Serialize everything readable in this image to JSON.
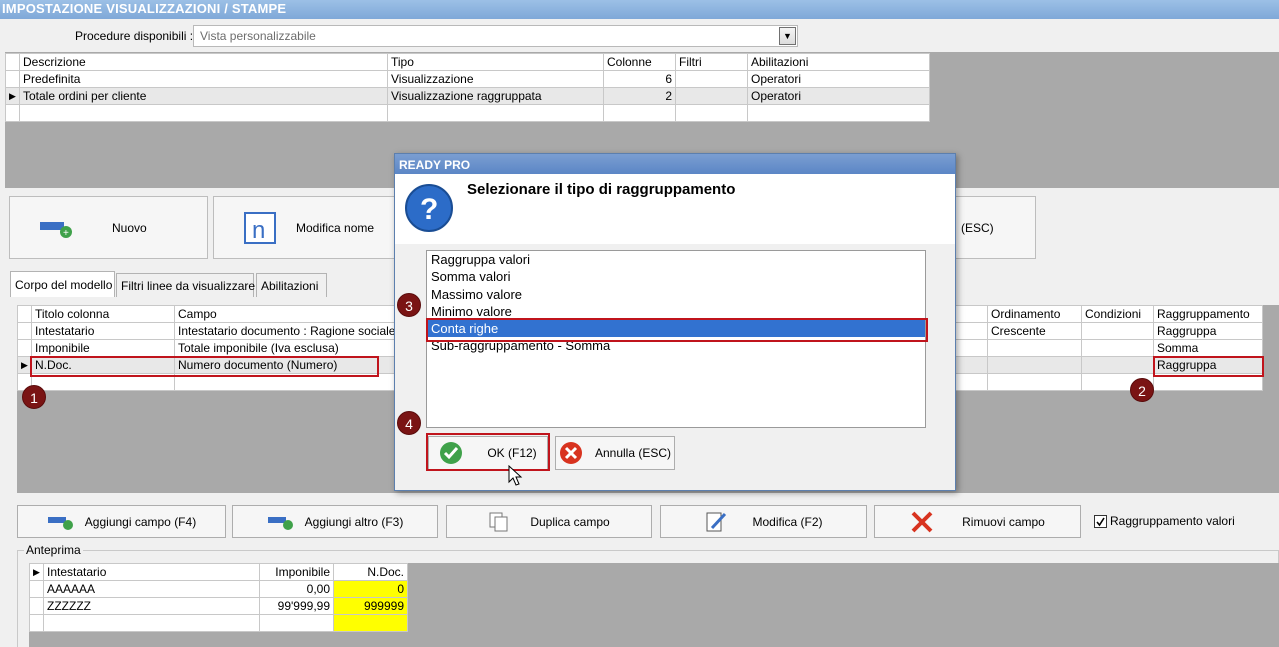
{
  "window": {
    "title": "IMPOSTAZIONE VISUALIZZAZIONI / STAMPE"
  },
  "procedure": {
    "label": "Procedure disponibili :",
    "value": "Vista personalizzabile"
  },
  "views_table": {
    "headers": [
      "Descrizione",
      "Tipo",
      "Colonne",
      "Filtri",
      "Abilitazioni"
    ],
    "rows": [
      {
        "descrizione": "Predefinita",
        "tipo": "Visualizzazione",
        "colonne": "6",
        "filtri": "",
        "abilitazioni": "Operatori"
      },
      {
        "descrizione": "Totale ordini per cliente",
        "tipo": "Visualizzazione raggruppata",
        "colonne": "2",
        "filtri": "",
        "abilitazioni": "Operatori"
      }
    ]
  },
  "toolbar": {
    "nuovo": "Nuovo",
    "modifica_nome": "Modifica nome",
    "esc_partial": "(ESC)"
  },
  "tabs": [
    "Corpo del modello",
    "Filtri linee da visualizzare",
    "Abilitazioni"
  ],
  "fields_table": {
    "headers": [
      "Titolo colonna",
      "Campo",
      "Ordinamento",
      "Condizioni",
      "Raggruppamento"
    ],
    "rows": [
      {
        "titolo": "Intestatario",
        "campo": "Intestatario documento : Ragione sociale",
        "ordinamento": "Crescente",
        "condizioni": "",
        "raggruppamento": "Raggruppa"
      },
      {
        "titolo": "Imponibile",
        "campo": "Totale imponibile (Iva esclusa)",
        "ordinamento": "",
        "condizioni": "",
        "raggruppamento": "Somma"
      },
      {
        "titolo": "N.Doc.",
        "campo": "Numero documento (Numero)",
        "ordinamento": "",
        "condizioni": "",
        "raggruppamento": "Raggruppa"
      }
    ]
  },
  "actions": {
    "aggiungi_campo": "Aggiungi campo (F4)",
    "aggiungi_altro": "Aggiungi altro (F3)",
    "duplica_campo": "Duplica campo",
    "modifica": "Modifica (F2)",
    "rimuovi_campo": "Rimuovi campo",
    "raggruppamento_valori": "Raggruppamento valori"
  },
  "preview": {
    "legend": "Anteprima",
    "headers": [
      "Intestatario",
      "Imponibile",
      "N.Doc."
    ],
    "rows": [
      {
        "intestatario": "AAAAAA",
        "imponibile": "0,00",
        "ndoc": "0"
      },
      {
        "intestatario": "ZZZZZZ",
        "imponibile": "99'999,99",
        "ndoc": "999999"
      }
    ]
  },
  "dialog": {
    "title": "READY PRO",
    "question": "Selezionare il tipo di raggruppamento",
    "options": [
      "Raggruppa valori",
      "Somma valori",
      "Massimo valore",
      "Minimo valore",
      "Conta righe",
      "Sub-raggruppamento - Somma"
    ],
    "selected_index": 4,
    "ok": "OK (F12)",
    "cancel": "Annulla (ESC)"
  },
  "badges": [
    "1",
    "2",
    "3",
    "4"
  ],
  "colors": {
    "highlight_red": "#c0141c",
    "yellow_cell": "#ffff00",
    "selection_blue": "#3272d0"
  }
}
